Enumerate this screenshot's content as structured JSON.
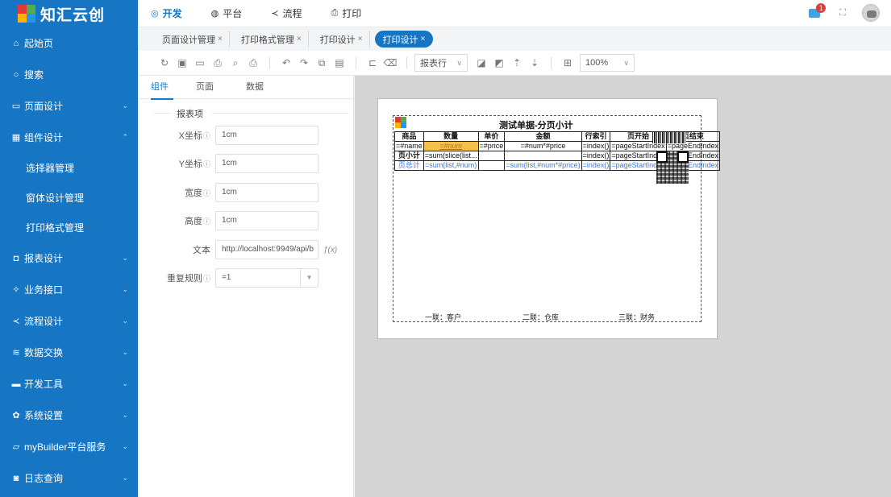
{
  "app": {
    "title": "知汇云创"
  },
  "sidebar": {
    "items": [
      {
        "label": "起始页",
        "icon": "home-icon",
        "glyph": "⌂",
        "chevron": ""
      },
      {
        "label": "搜索",
        "icon": "search-icon",
        "glyph": "○",
        "chevron": ""
      },
      {
        "label": "页面设计",
        "icon": "page-icon",
        "glyph": "▭",
        "chevron": "⌄"
      },
      {
        "label": "组件设计",
        "icon": "grid-icon",
        "glyph": "▦",
        "chevron": "⌃"
      },
      {
        "label": "选择器管理",
        "sub": true
      },
      {
        "label": "窗体设计管理",
        "sub": true
      },
      {
        "label": "打印格式管理",
        "sub": true
      },
      {
        "label": "报表设计",
        "icon": "report-icon",
        "glyph": "◘",
        "chevron": "⌄"
      },
      {
        "label": "业务接口",
        "icon": "interface-icon",
        "glyph": "✧",
        "chevron": "⌄"
      },
      {
        "label": "流程设计",
        "icon": "flow-icon",
        "glyph": "≺",
        "chevron": "⌄"
      },
      {
        "label": "数据交换",
        "icon": "database-icon",
        "glyph": "≋",
        "chevron": "⌄"
      },
      {
        "label": "开发工具",
        "icon": "toolbox-icon",
        "glyph": "▬",
        "chevron": "⌄"
      },
      {
        "label": "系统设置",
        "icon": "gear-icon",
        "glyph": "✿",
        "chevron": "⌄"
      },
      {
        "label": "myBuilder平台服务",
        "icon": "service-icon",
        "glyph": "▱",
        "chevron": "⌄"
      },
      {
        "label": "日志查询",
        "icon": "log-icon",
        "glyph": "◙",
        "chevron": "⌄"
      }
    ]
  },
  "topnav": {
    "items": [
      {
        "label": "开发",
        "glyph": "◎",
        "active": true
      },
      {
        "label": "平台",
        "glyph": "◍",
        "active": false
      },
      {
        "label": "流程",
        "glyph": "≺",
        "active": false
      },
      {
        "label": "打印",
        "glyph": "⎙",
        "active": false
      }
    ],
    "badge": "1"
  },
  "tabs": [
    {
      "label": "页面设计管理",
      "close": "×",
      "active": false
    },
    {
      "label": "打印格式管理",
      "close": "×",
      "active": false
    },
    {
      "label": "打印设计",
      "close": "×",
      "active": false
    },
    {
      "label": "打印设计",
      "close": "×",
      "active": true
    }
  ],
  "toolbar": {
    "band_select": "报表行",
    "zoom_select": "100%"
  },
  "panel": {
    "tabs": [
      "组件",
      "页面",
      "数据"
    ],
    "group_title": "报表项",
    "fields": {
      "x": {
        "label": "X坐标",
        "value": "1cm"
      },
      "y": {
        "label": "Y坐标",
        "value": "1cm"
      },
      "width": {
        "label": "宽度",
        "value": "1cm"
      },
      "height": {
        "label": "高度",
        "value": "1cm"
      },
      "text": {
        "label": "文本",
        "value": "http://localhost:9949/api/b",
        "fx": "ƒ(x)"
      },
      "repeat": {
        "label": "重复规则",
        "value": "=1"
      }
    },
    "info_glyph": "ⓘ"
  },
  "document": {
    "title": "测试单据-分页小计",
    "headers": [
      "商品",
      "数量",
      "单价",
      "金额",
      "行索引",
      "页开始",
      "页结束"
    ],
    "row_detail": [
      "=#name",
      "=#num",
      "=#price",
      "=#num*#price",
      "=index()",
      "=pageStartIndex",
      "=pageEndIndex"
    ],
    "row_page_sum": [
      "页小计",
      "=sum(slice(list...",
      "",
      "",
      "=index()",
      "=pageStartIndex",
      "=pageEndIndex"
    ],
    "row_total": [
      "页总计",
      "=sum(list,#num)",
      "",
      "=sum(list,#num*#price)",
      "=index()",
      "=pageStartIndex",
      "=pageEndIndex"
    ],
    "copies": [
      "一联：客户",
      "二联：仓库",
      "三联：财务"
    ]
  },
  "colors": {
    "primary": "#1676c4",
    "highlight": "#f5c04a",
    "formula_blue": "#3a78d9"
  }
}
